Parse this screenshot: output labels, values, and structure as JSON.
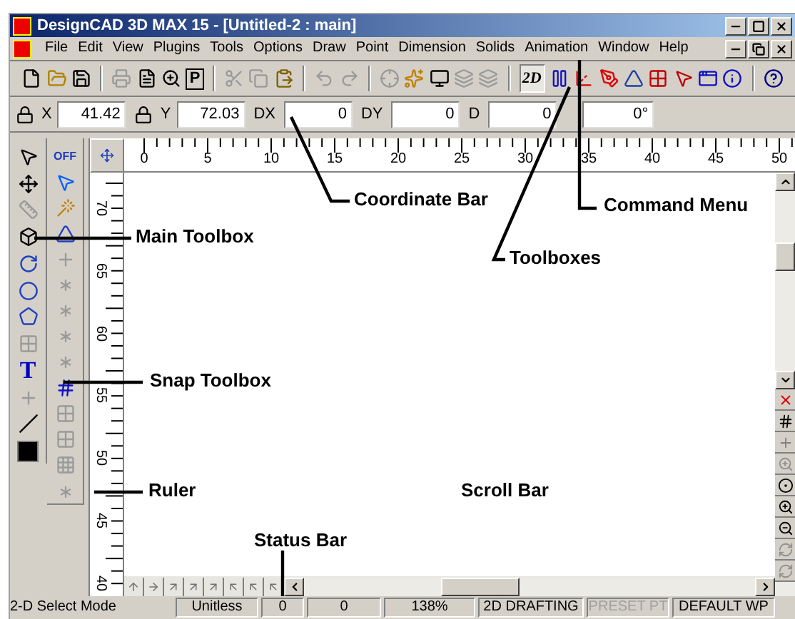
{
  "window": {
    "title": "DesignCAD 3D MAX 15 - [Untitled-2 : main]"
  },
  "menu": [
    "File",
    "Edit",
    "View",
    "Plugins",
    "Tools",
    "Options",
    "Draw",
    "Point",
    "Dimension",
    "Solids",
    "Animation",
    "Window",
    "Help"
  ],
  "toolbar": {
    "letter_icon": "P",
    "mode_button": {
      "label": "2D",
      "pressed": true
    }
  },
  "coordinate_bar": {
    "fields": [
      {
        "kind": "lock",
        "label": "X",
        "value": "41.42"
      },
      {
        "kind": "lock",
        "label": "Y",
        "value": "72.03"
      },
      {
        "kind": "text",
        "label": "DX",
        "value": "0"
      },
      {
        "kind": "text",
        "label": "DY",
        "value": "0"
      },
      {
        "kind": "text",
        "label": "D",
        "value": "0"
      },
      {
        "kind": "bare",
        "value": "0°"
      }
    ]
  },
  "snap_toolbox": {
    "off_button": "OFF"
  },
  "main_toolbox": {
    "text_tool": "T"
  },
  "ruler": {
    "horizontal": [
      "0",
      "5",
      "10",
      "15",
      "20",
      "25",
      "30",
      "35",
      "40",
      "45",
      "50"
    ],
    "vertical": [
      "70",
      "65",
      "60",
      "55",
      "50",
      "45",
      "40"
    ]
  },
  "status_bar": {
    "mode": "2-D Select Mode",
    "cells": [
      {
        "text": "Unitless",
        "disabled": false
      },
      {
        "text": "0",
        "disabled": false
      },
      {
        "text": "0",
        "disabled": false
      },
      {
        "text": "138%",
        "disabled": false
      },
      {
        "text": "2D DRAFTING",
        "disabled": false
      },
      {
        "text": "PRESET PT",
        "disabled": true
      },
      {
        "text": "DEFAULT WP",
        "disabled": false
      }
    ]
  },
  "annotations": [
    {
      "label": "Coordinate Bar"
    },
    {
      "label": "Command Menu"
    },
    {
      "label": "Toolboxes"
    },
    {
      "label": "Main Toolbox"
    },
    {
      "label": "Snap Toolbox"
    },
    {
      "label": "Ruler"
    },
    {
      "label": "Scroll Bar"
    },
    {
      "label": "Status Bar"
    }
  ]
}
